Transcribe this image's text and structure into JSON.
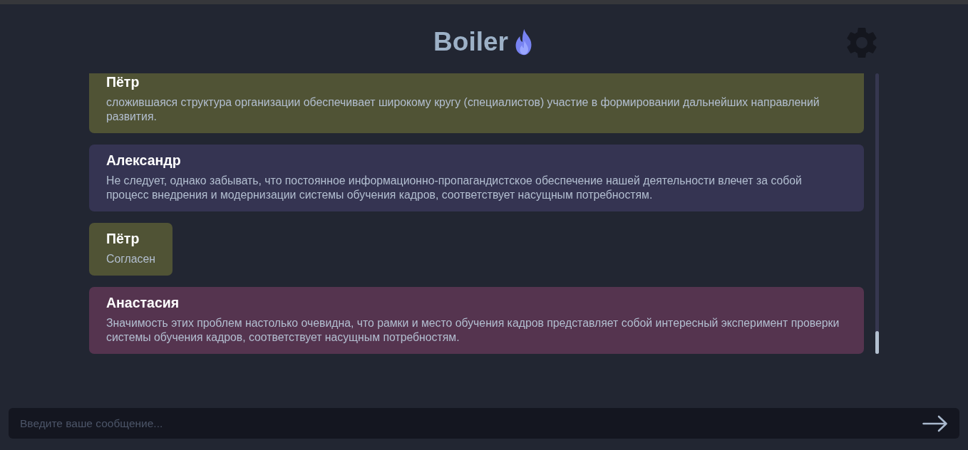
{
  "header": {
    "title": "Boiler"
  },
  "messages": [
    {
      "sender": "Пётр",
      "text": "сложившаяся структура организации обеспечивает широкому кругу (специалистов) участие в формировании дальнейших направлений развития.",
      "color": "#505335"
    },
    {
      "sender": "Александр",
      "text": "Не следует, однако забывать, что постоянное информационно-пропагандистское обеспечение нашей деятельности влечет за собой процесс внедрения и модернизации системы обучения кадров, соответствует насущным потребностям.",
      "color": "#353452"
    },
    {
      "sender": "Пётр",
      "text": "Согласен",
      "color": "#505335"
    },
    {
      "sender": "Анастасия",
      "text": "Значимость этих проблем настолько очевидна, что рамки и место обучения кадров представляет собой интересный эксперимент проверки системы обучения кадров, соответствует насущным потребностям.",
      "color": "#55344f"
    }
  ],
  "composer": {
    "placeholder": "Введите ваше сообщение..."
  }
}
